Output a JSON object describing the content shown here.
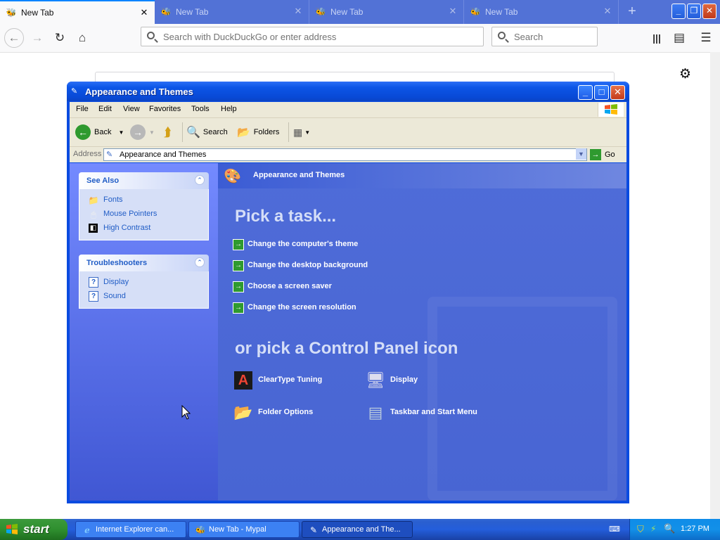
{
  "browser": {
    "tabs": [
      {
        "label": "New Tab",
        "active": true
      },
      {
        "label": "New Tab",
        "active": false
      },
      {
        "label": "New Tab",
        "active": false
      },
      {
        "label": "New Tab",
        "active": false
      }
    ],
    "url_placeholder": "Search with DuckDuckGo or enter address",
    "search_placeholder": "Search"
  },
  "window": {
    "title": "Appearance and Themes",
    "menu": [
      "File",
      "Edit",
      "View",
      "Favorites",
      "Tools",
      "Help"
    ],
    "toolbar": {
      "back": "Back",
      "search": "Search",
      "folders": "Folders"
    },
    "address_label": "Address",
    "address_value": "Appearance and Themes",
    "go_label": "Go"
  },
  "left_pane": {
    "see_also": {
      "title": "See Also",
      "items": [
        {
          "label": "Fonts",
          "icon": "folder-icon"
        },
        {
          "label": "Mouse Pointers",
          "icon": "mouse-icon"
        },
        {
          "label": "High Contrast",
          "icon": "contrast-icon"
        }
      ]
    },
    "troubleshooters": {
      "title": "Troubleshooters",
      "items": [
        {
          "label": "Display",
          "icon": "help-icon"
        },
        {
          "label": "Sound",
          "icon": "help-icon"
        }
      ]
    }
  },
  "main": {
    "header": "Appearance and Themes",
    "pick_task": "Pick a task...",
    "tasks": [
      "Change the computer's theme",
      "Change the desktop background",
      "Choose a screen saver",
      "Change the screen resolution"
    ],
    "pick_icon": "or pick a Control Panel icon",
    "icons": [
      {
        "label": "ClearType Tuning",
        "icon": "cleartype-icon"
      },
      {
        "label": "Display",
        "icon": "display-icon"
      },
      {
        "label": "Folder Options",
        "icon": "folder-options-icon"
      },
      {
        "label": "Taskbar and Start Menu",
        "icon": "taskbar-icon"
      }
    ]
  },
  "taskbar": {
    "start": "start",
    "tasks": [
      {
        "label": "Internet Explorer can...",
        "active": false
      },
      {
        "label": "New Tab - Mypal",
        "active": false
      },
      {
        "label": "Appearance and The...",
        "active": true
      }
    ],
    "clock": "1:27 PM"
  }
}
